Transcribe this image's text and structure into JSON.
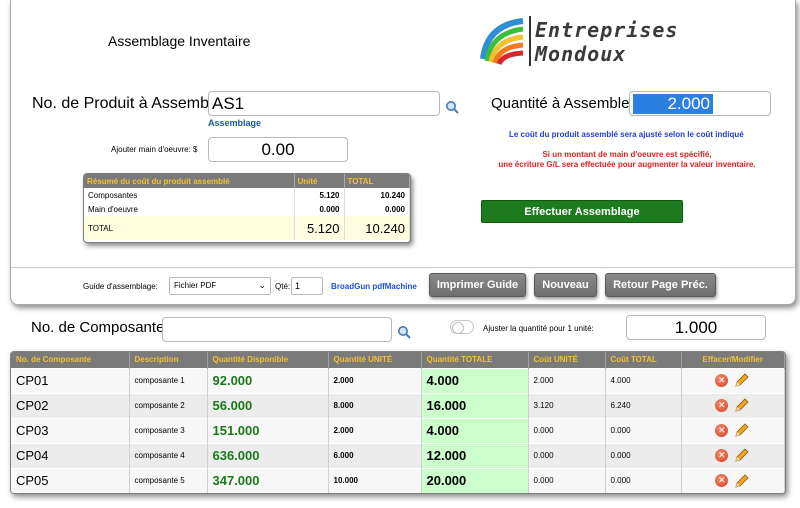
{
  "header": {
    "title": "Assemblage Inventaire",
    "logo_line1": "Entreprises",
    "logo_line2": "Mondoux"
  },
  "product": {
    "label": "No. de Produit à Assembler:",
    "value": "AS1",
    "sublink": "Assemblage"
  },
  "quantity": {
    "label": "Quantité à Assembler:",
    "value": "2.000"
  },
  "labour": {
    "label": "Ajouter main d'oeuvre: $",
    "value": "0.00"
  },
  "notes": {
    "blue": "Le coût du produit assemblé sera ajusté selon le coût indiqué",
    "red_line1": "Si un montant de main d'oeuvre est spécifié,",
    "red_line2": "une écriture G/L sera effectuée pour augmenter la valeur inventaire."
  },
  "summary": {
    "headers": [
      "Résumé du coût du produit assemblé",
      "Unité",
      "TOTAL"
    ],
    "rows": [
      {
        "label": "Composantes",
        "unit": "5.120",
        "total": "10.240"
      },
      {
        "label": "Main d'oeuvre",
        "unit": "0.000",
        "total": "0.000"
      }
    ],
    "total_row": {
      "label": "TOTAL",
      "unit": "5.120",
      "total": "10.240"
    }
  },
  "actions": {
    "perform": "Effectuer Assemblage",
    "print": "Imprimer Guide",
    "new": "Nouveau",
    "back": "Retour Page Préc."
  },
  "guide": {
    "label": "Guide d'assemblage:",
    "selected": "Fichier PDF",
    "qty_label": "Qté:",
    "qty_value": "1",
    "link": "BroadGun pdfMachine"
  },
  "component_search": {
    "label": "No. de Composante:",
    "value": "",
    "toggle_label": "Ajuster la quantité pour 1 unité:",
    "unit_qty": "1.000"
  },
  "components": {
    "headers": [
      "No. de Composante",
      "Description",
      "Quantité Disponible",
      "Quantité UNITÉ",
      "Quantité TOTALE",
      "Coût UNITÉ",
      "Coût TOTAL",
      "Effacer/Modifier"
    ],
    "rows": [
      {
        "code": "CP01",
        "desc": "composante 1",
        "avail": "92.000",
        "unit_qty": "2.000",
        "total_qty": "4.000",
        "unit_cost": "2.000",
        "total_cost": "4.000"
      },
      {
        "code": "CP02",
        "desc": "composante 2",
        "avail": "56.000",
        "unit_qty": "8.000",
        "total_qty": "16.000",
        "unit_cost": "3.120",
        "total_cost": "6.240"
      },
      {
        "code": "CP03",
        "desc": "composante 3",
        "avail": "151.000",
        "unit_qty": "2.000",
        "total_qty": "4.000",
        "unit_cost": "0.000",
        "total_cost": "0.000"
      },
      {
        "code": "CP04",
        "desc": "composante 4",
        "avail": "636.000",
        "unit_qty": "6.000",
        "total_qty": "12.000",
        "unit_cost": "0.000",
        "total_cost": "0.000"
      },
      {
        "code": "CP05",
        "desc": "composante 5",
        "avail": "347.000",
        "unit_qty": "10.000",
        "total_qty": "20.000",
        "unit_cost": "0.000",
        "total_cost": "0.000"
      }
    ]
  },
  "colors": {
    "header_bg": "#7a7a7a",
    "header_text": "#f1c232",
    "green_button": "#1e7a1e",
    "qty_highlight": "#2b7fe0",
    "total_col_bg": "#ccffcc"
  }
}
